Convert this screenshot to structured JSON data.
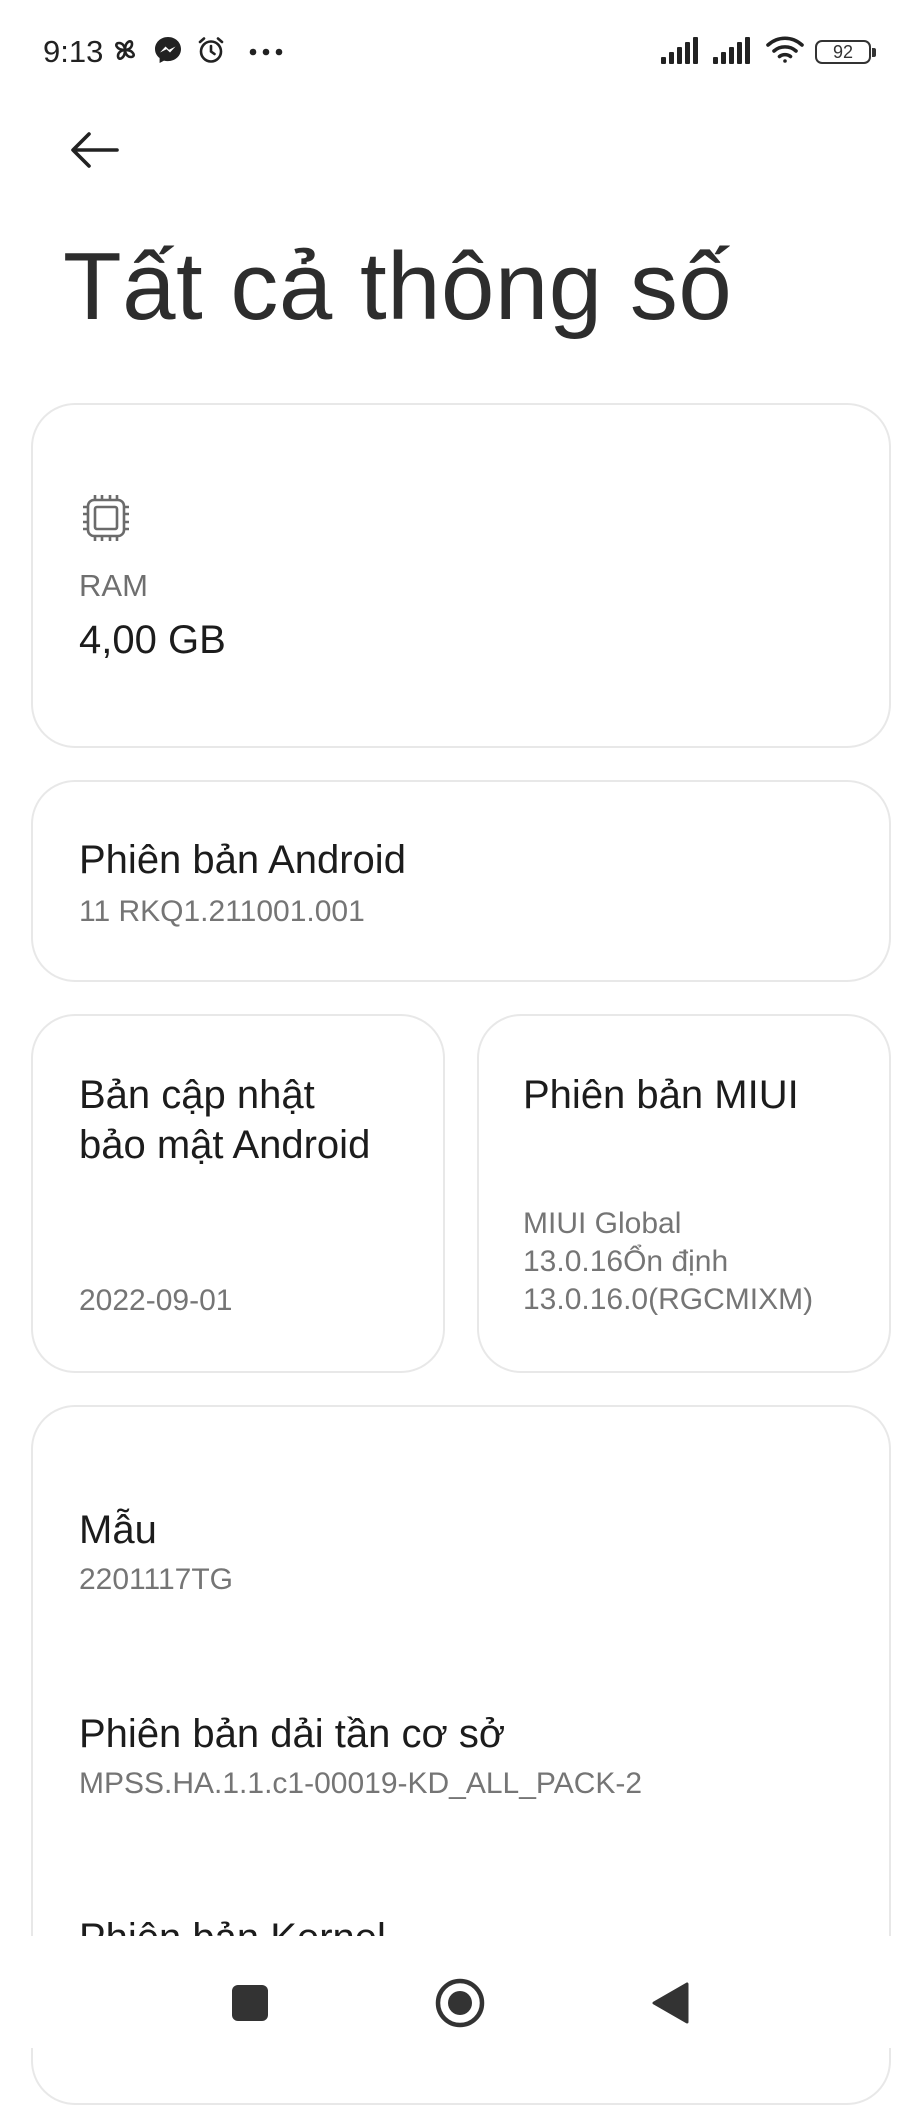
{
  "status_bar": {
    "time": "9:13",
    "battery_level": "92",
    "left_icons": [
      "pinwheel-icon",
      "messenger-icon",
      "alarm-icon",
      "more-dots-icon"
    ],
    "right_icons": [
      "signal-icon",
      "signal-icon",
      "wifi-icon",
      "battery-icon"
    ]
  },
  "header": {
    "back_icon": "back-arrow-icon",
    "title": "Tất cả thông số"
  },
  "cards": {
    "ram": {
      "icon": "chip-icon",
      "label": "RAM",
      "value": "4,00 GB"
    },
    "android_version": {
      "title": "Phiên bản Android",
      "value": "11 RKQ1.211001.001"
    },
    "security_patch": {
      "title_line1": "Bản cập nhật",
      "title_line2": "bảo mật Android",
      "value": "2022-09-01"
    },
    "miui_version": {
      "title": "Phiên bản MIUI",
      "value_line1": "MIUI Global",
      "value_line2": "13.0.16Ổn định",
      "value_line3": "13.0.16.0(RGCMIXM)"
    },
    "details": [
      {
        "title": "Mẫu",
        "value": "2201117TG"
      },
      {
        "title": "Phiên bản dải tần cơ sở",
        "value": "MPSS.HA.1.1.c1-00019-KD_ALL_PACK-2"
      },
      {
        "title": "Phiên bản Kernel",
        "value": ""
      }
    ]
  },
  "nav_bar": {
    "icons": [
      "recents-square-icon",
      "home-circle-icon",
      "back-triangle-icon"
    ]
  },
  "colors": {
    "background": "#ffffff",
    "card_border": "#e8e8e8",
    "primary_text": "#1c1c1c",
    "secondary_text": "#757575"
  }
}
